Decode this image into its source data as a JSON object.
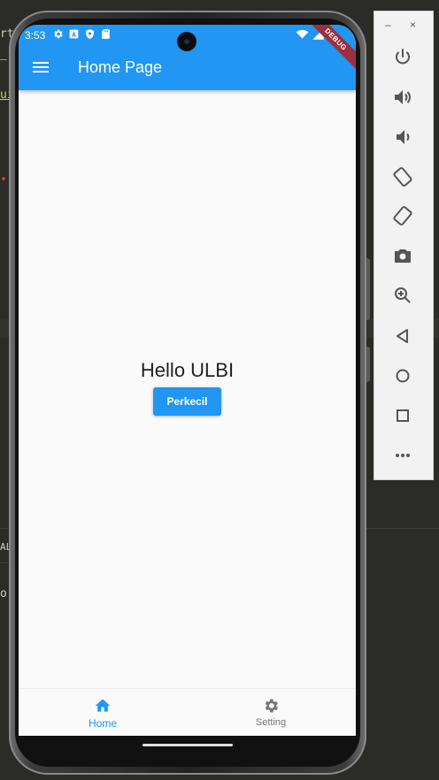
{
  "status_bar": {
    "time": "3:53",
    "debug_label": "DEBUG"
  },
  "app_bar": {
    "title": "Home Page"
  },
  "body": {
    "greeting": "Hello ULBI",
    "button_label": "Perkecil"
  },
  "bottom_nav": {
    "items": [
      {
        "label": "Home",
        "icon": "home-icon",
        "active": true
      },
      {
        "label": "Setting",
        "icon": "settings-icon",
        "active": false
      }
    ]
  },
  "editor_fragments": {
    "line1": "rt",
    "line3": "ui",
    "line_al": "AL",
    "line_or": "or"
  },
  "emulator_toolbar": {
    "minimize": "–",
    "close": "×",
    "buttons": [
      "power-icon",
      "volume-up-icon",
      "volume-down-icon",
      "rotate-left-icon",
      "rotate-right-icon",
      "camera-icon",
      "zoom-icon",
      "back-icon",
      "home-circle-icon",
      "overview-icon",
      "more-icon"
    ]
  },
  "colors": {
    "primary": "#2196f3",
    "background": "#fafafa",
    "debug_banner": "#9c2f3d",
    "nav_inactive": "#757575"
  }
}
